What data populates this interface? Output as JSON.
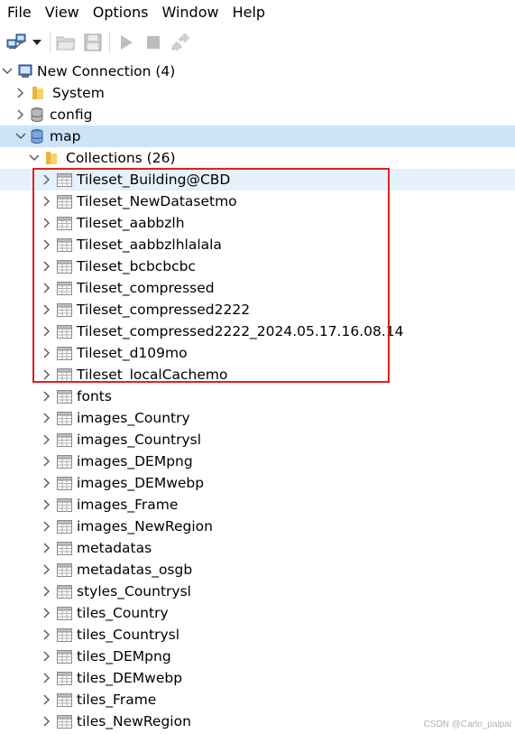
{
  "menu": {
    "items": [
      {
        "label": "File"
      },
      {
        "label": "View"
      },
      {
        "label": "Options"
      },
      {
        "label": "Window"
      },
      {
        "label": "Help"
      }
    ]
  },
  "toolbar": {
    "buttons": [
      {
        "icon": "connect-icon",
        "enabled": true
      },
      {
        "icon": "dropdown-arrow-icon",
        "enabled": true
      },
      {
        "icon": "open-folder-icon",
        "enabled": false
      },
      {
        "icon": "save-icon",
        "enabled": false
      },
      {
        "icon": "run-icon",
        "enabled": false
      },
      {
        "icon": "stop-icon",
        "enabled": false
      },
      {
        "icon": "disconnect-icon",
        "enabled": false
      }
    ]
  },
  "tree": {
    "connection": {
      "label": "New Connection (4)",
      "expanded": true
    },
    "databases": [
      {
        "label": "System",
        "icon": "folder-icon",
        "expanded": false
      },
      {
        "label": "config",
        "icon": "database-icon",
        "expanded": false
      },
      {
        "label": "map",
        "icon": "database-icon",
        "expanded": true,
        "selected": true
      }
    ],
    "collections_folder": {
      "label": "Collections (26)",
      "expanded": true
    },
    "collections": [
      "Tileset_Building@CBD",
      "Tileset_NewDatasetmo",
      "Tileset_aabbzlh",
      "Tileset_aabbzlhlalala",
      "Tileset_bcbcbcbc",
      "Tileset_compressed",
      "Tileset_compressed2222",
      "Tileset_compressed2222_2024.05.17.16.08.14",
      "Tileset_d109mo",
      "Tileset_localCachemo",
      "fonts",
      "images_Country",
      "images_Countrysl",
      "images_DEMpng",
      "images_DEMwebp",
      "images_Frame",
      "images_NewRegion",
      "metadatas",
      "metadatas_osgb",
      "styles_Countrysl",
      "tiles_Country",
      "tiles_Countrysl",
      "tiles_DEMpng",
      "tiles_DEMwebp",
      "tiles_Frame",
      "tiles_NewRegion"
    ],
    "hovered_collection": "Tileset_Building@CBD"
  },
  "colors": {
    "selection": "#cce4f7",
    "hover": "#e5f1fb",
    "highlight_border": "#e02020"
  },
  "watermark": "CSDN @Carlo_paipai"
}
